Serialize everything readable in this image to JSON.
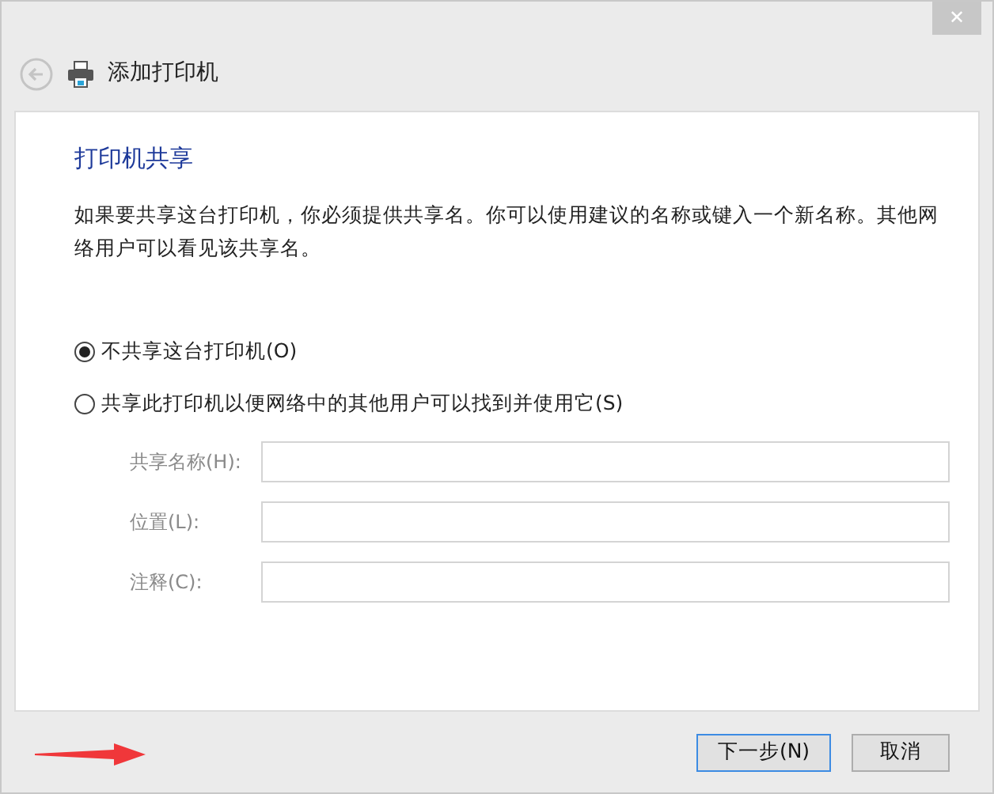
{
  "window": {
    "title": "添加打印机",
    "close": "✕"
  },
  "heading": "打印机共享",
  "description": "如果要共享这台打印机，你必须提供共享名。你可以使用建议的名称或键入一个新名称。其他网络用户可以看见该共享名。",
  "options": [
    {
      "label": "不共享这台打印机(O)",
      "selected": true
    },
    {
      "label": "共享此打印机以便网络中的其他用户可以找到并使用它(S)",
      "selected": false
    }
  ],
  "fields": [
    {
      "label": "共享名称(H):",
      "disabled": true
    },
    {
      "label": "位置(L):",
      "disabled": true
    },
    {
      "label": "注释(C):",
      "disabled": true
    }
  ],
  "buttons": [
    {
      "label": "下一步(N)",
      "focused": true
    },
    {
      "label": "取消",
      "focused": false
    }
  ]
}
